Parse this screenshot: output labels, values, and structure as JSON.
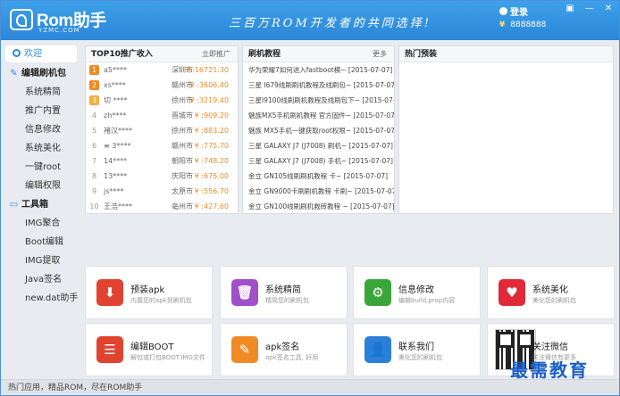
{
  "header": {
    "logo_text": "Rom助手",
    "logo_sub": "YZMC.COM",
    "slogan": "三百万ROM开发者的共同选择!",
    "login_label": "登录",
    "coins": "8888888",
    "coin_symbol": "¥"
  },
  "window_controls": {
    "skin": "▣",
    "minimize": "—",
    "close": "✕"
  },
  "sidebar": {
    "welcome": "欢迎",
    "group1": "编辑刷机包",
    "group1_items": [
      "系统精简",
      "推广内置",
      "信息修改",
      "系统美化",
      "一键root",
      "编辑权限"
    ],
    "group2": "工具箱",
    "group2_items": [
      "IMG聚合",
      "Boot编辑",
      "IMG提取",
      "Java签名",
      "new.dat助手"
    ]
  },
  "panel_rank": {
    "title": "TOP10推广收入",
    "more": "立即推广",
    "rows": [
      {
        "n": "1",
        "user": "a5****",
        "city": "深圳市",
        "amt": "¥ :16721.30"
      },
      {
        "n": "2",
        "user": "xs****",
        "city": "赣州市",
        "amt": "¥ :3606.40"
      },
      {
        "n": "3",
        "user": "切 ****",
        "city": "徐州市",
        "amt": "¥ :3219.40"
      },
      {
        "n": "4",
        "user": "zh****",
        "city": "晋城市",
        "amt": "¥ :909.20"
      },
      {
        "n": "5",
        "user": "褚汉****",
        "city": "徐州市",
        "amt": "¥ :883.20"
      },
      {
        "n": "6",
        "user": "≡ 3****",
        "city": "赣州市",
        "amt": "¥ :775.70"
      },
      {
        "n": "7",
        "user": "14****",
        "city": "朝阳市",
        "amt": "¥ :748.20"
      },
      {
        "n": "8",
        "user": "13****",
        "city": "庆阳市",
        "amt": "¥ :675.00"
      },
      {
        "n": "9",
        "user": "js****",
        "city": "太原市",
        "amt": "¥ :556.70"
      },
      {
        "n": "10",
        "user": "王浩****",
        "city": "亳州市",
        "amt": "¥ :427.60"
      }
    ]
  },
  "panel_tutorial": {
    "title": "刷机教程",
    "more": "更多",
    "rows": [
      "华为荣耀7如何进入fastboot模~ [2015-07-07]",
      "三星 I679线刷刷机教程及线刷包~ [2015-07-07]",
      "三星I9100线刷刷机教程及线刷包下~ [2015-07-07]",
      "魅族MX5手机刷机教程 官方固件~ [2015-07-07]",
      "魅族 MX5手机一键获取root权限~ [2015-07-07]",
      "三星 GALAXY J7 (J7008) 刷机~ [2015-07-07]",
      "三星 GALAXY J7 (J7008) 手机~ [2015-07-07]",
      "金立 GN105线刷刷机教程 卡~ [2015-07-07]",
      "金立 GN9000卡刷刷机教程 卡刷~ [2015-07-07]",
      "金立 GN100线刷刷机救砖教程 ~ [2015-07-07]"
    ]
  },
  "panel_hot": {
    "title": "热门预装"
  },
  "tiles": [
    {
      "title": "预装apk",
      "desc": "内置您的apk到刷机包",
      "color": "#e0432f",
      "glyph": "⬇"
    },
    {
      "title": "系统精简",
      "desc": "精简您的刷机包",
      "color": "#a050c8",
      "glyph": "🗑"
    },
    {
      "title": "信息修改",
      "desc": "编辑build.prop内容",
      "color": "#3aa63a",
      "glyph": "⚙"
    },
    {
      "title": "系统美化",
      "desc": "美化您的刷机包",
      "color": "#e02a3a",
      "glyph": "♥"
    },
    {
      "title": "编辑BOOT",
      "desc": "解包或打包BOOT.IMG文件",
      "color": "#e0432f",
      "glyph": "☰"
    },
    {
      "title": "apk签名",
      "desc": "apk签名工具, 好用",
      "color": "#f08a24",
      "glyph": "✎"
    },
    {
      "title": "联系我们",
      "desc": "美化您的刷机包",
      "color": "#2b7fd6",
      "glyph": "👤"
    },
    {
      "title": "关注微信",
      "desc": "关注微信有更多",
      "color": "#ffffff",
      "glyph": ""
    }
  ],
  "watermark": "最需教育",
  "status_bar": "热门应用，精品ROM，尽在ROM助手"
}
